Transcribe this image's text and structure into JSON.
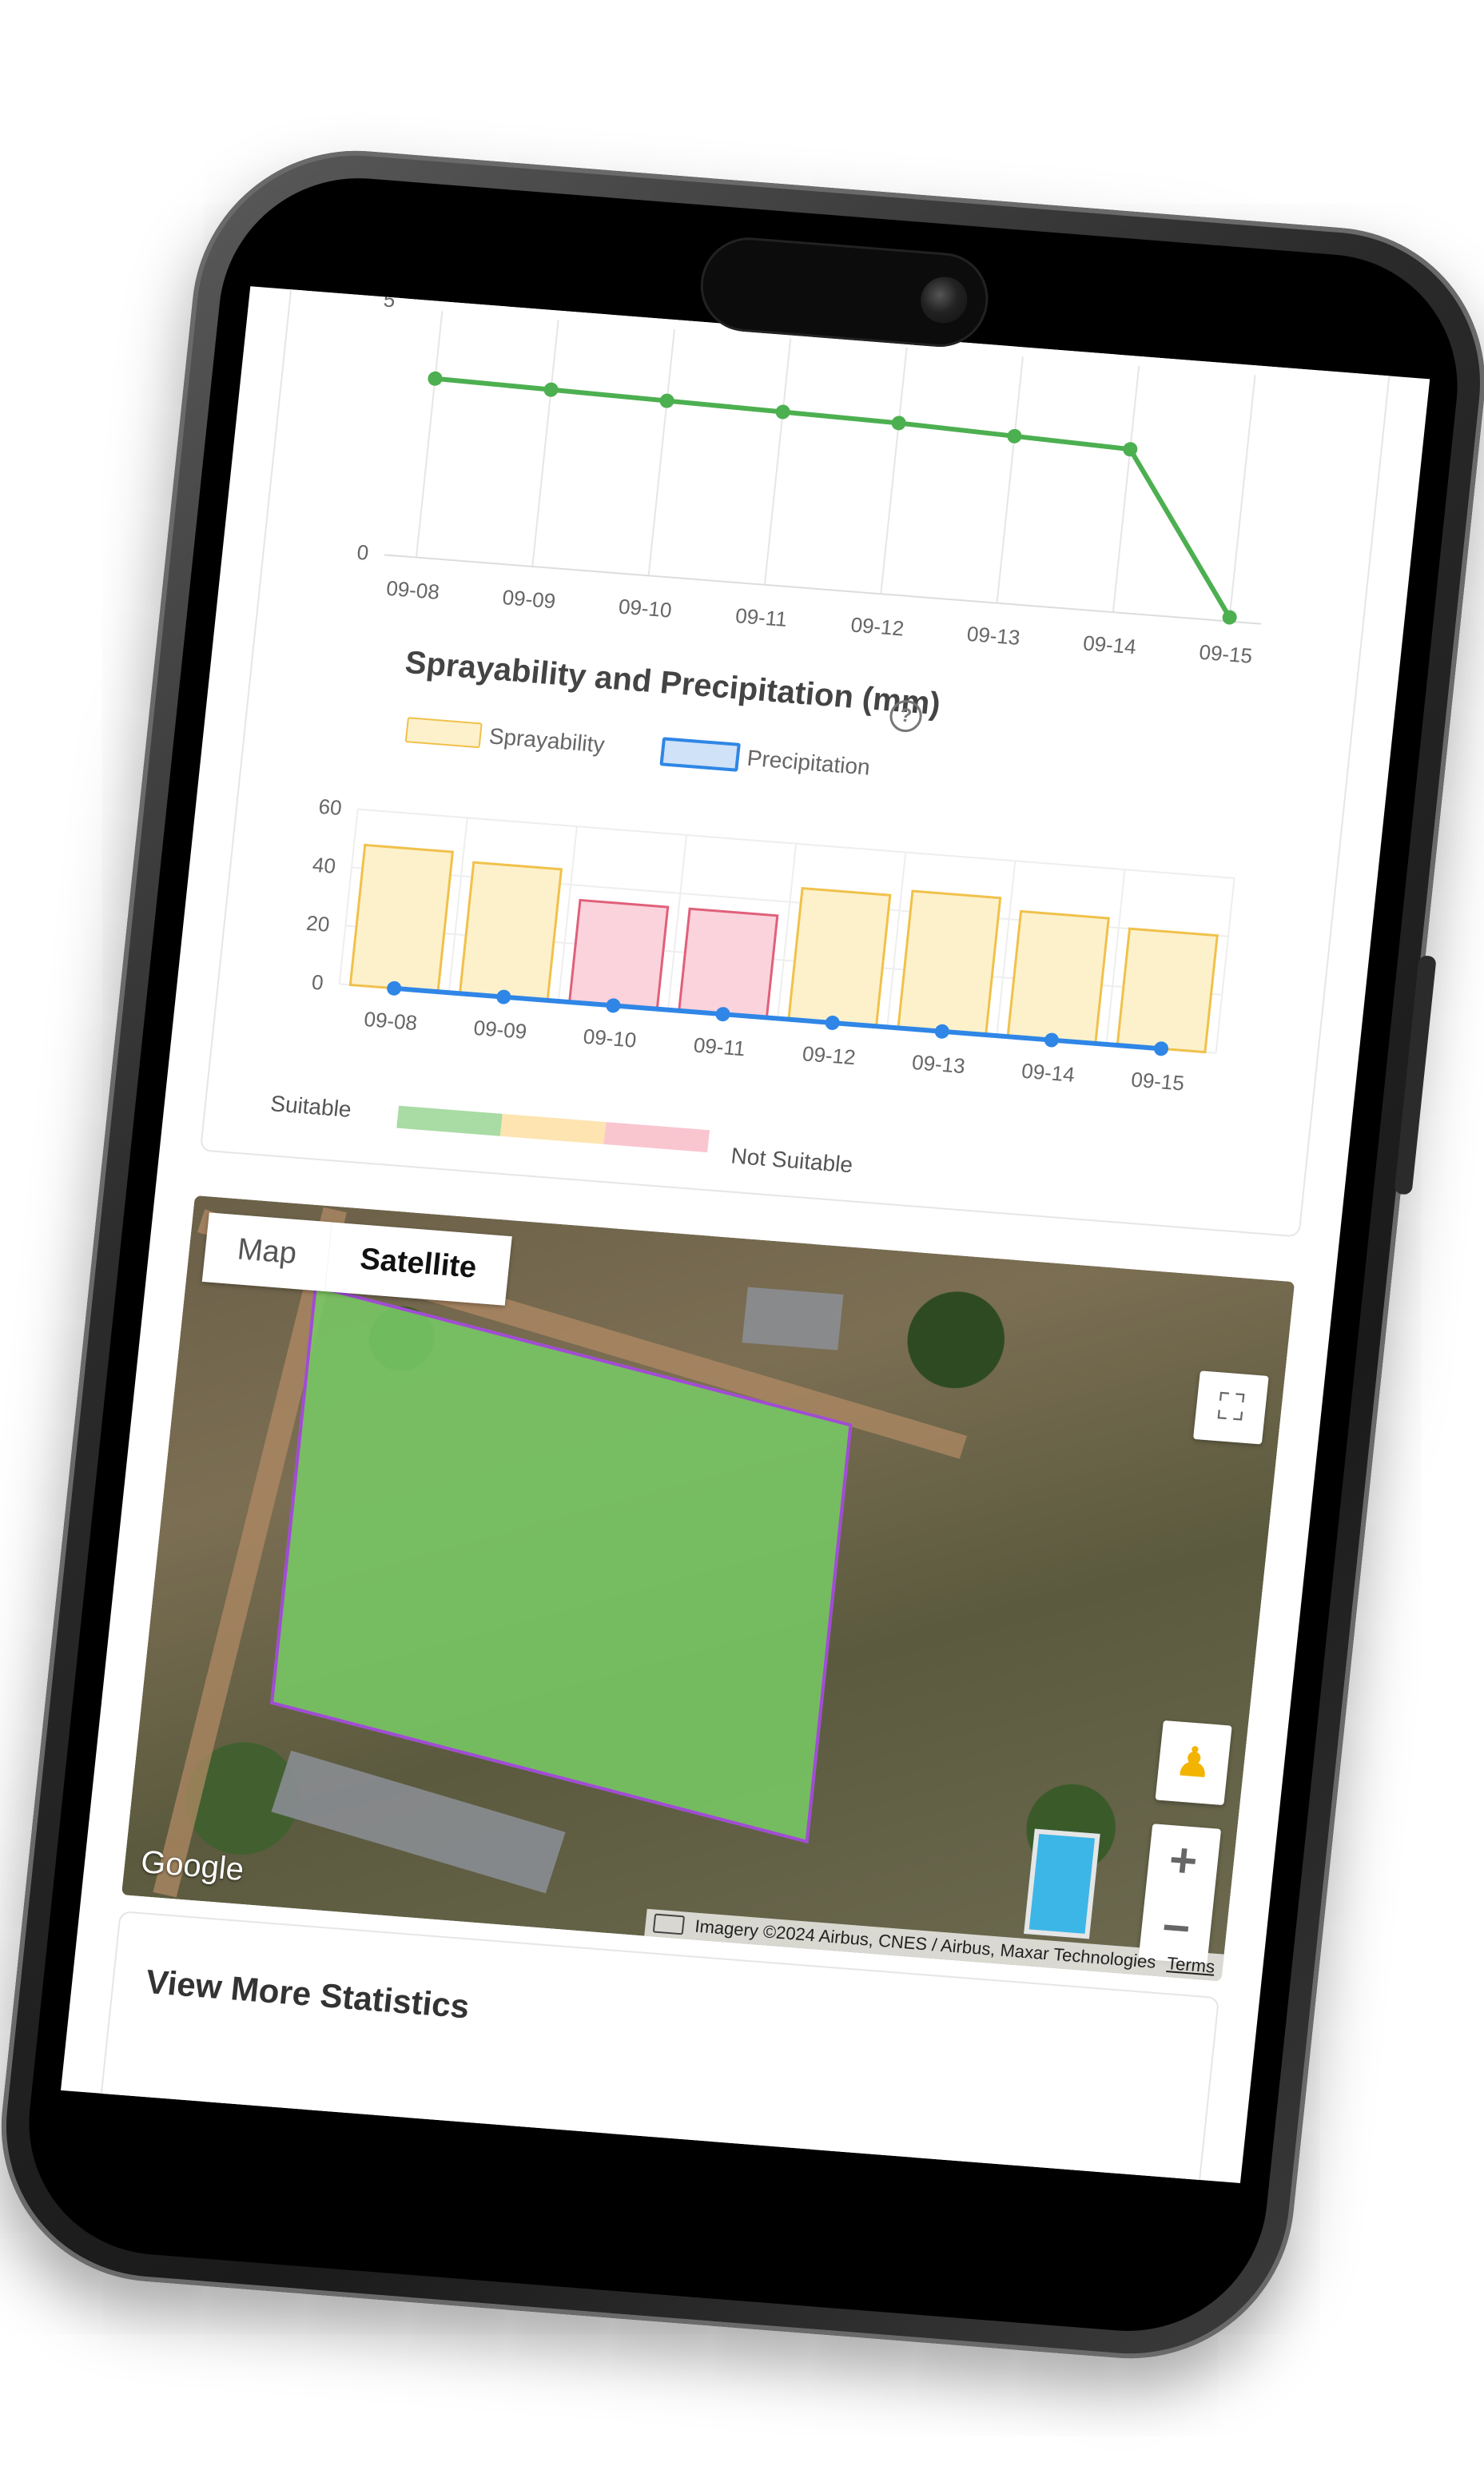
{
  "line_chart": {
    "y_ticks": [
      "5",
      "0"
    ],
    "x_labels": [
      "09-08",
      "09-09",
      "09-10",
      "09-11",
      "09-12",
      "09-13",
      "09-14",
      "09-15"
    ]
  },
  "spray_chart": {
    "title": "Sprayability and Precipitation (mm)",
    "help_icon": "?",
    "legend": {
      "sprayability": "Sprayability",
      "precipitation": "Precipitation"
    },
    "y_ticks": [
      "60",
      "40",
      "20",
      "0"
    ],
    "scale": {
      "suitable": "Suitable",
      "not_suitable": "Not Suitable"
    }
  },
  "map": {
    "tabs": [
      "Map",
      "Satellite"
    ],
    "active_tab": "Satellite",
    "google": "Google",
    "attribution": "Imagery ©2024 Airbus, CNES / Airbus, Maxar Technologies",
    "terms": "Terms",
    "zoom_in": "+",
    "zoom_out": "−"
  },
  "stats": {
    "title": "View More Statistics",
    "expand": "+"
  },
  "colors": {
    "line": "#4caf50",
    "spray_fill": "#fdf1cc",
    "spray_stroke": "#f0c14b",
    "spray_bad_fill": "#fbd3dc",
    "spray_bad_stroke": "#e0607a",
    "precip": "#2f86e6",
    "suit_good": "#a9dba5",
    "suit_mid": "#fde4b0",
    "suit_bad": "#f9c6d0",
    "field": "#78c864",
    "field_border": "#a24bd6"
  },
  "chart_data": [
    {
      "type": "line",
      "x": [
        "09-08",
        "09-09",
        "09-10",
        "09-11",
        "09-12",
        "09-13",
        "09-14",
        "09-15"
      ],
      "series": [
        {
          "values": [
            4.5,
            4.45,
            4.4,
            4.35,
            4.3,
            4.2,
            4.1,
            0.1
          ]
        }
      ],
      "ylim": [
        0,
        5
      ]
    },
    {
      "type": "bar",
      "title": "Sprayability and Precipitation (mm)",
      "categories": [
        "09-08",
        "09-09",
        "09-10",
        "09-11",
        "09-12",
        "09-13",
        "09-14",
        "09-15"
      ],
      "series": [
        {
          "name": "Sprayability",
          "values": [
            48,
            45,
            35,
            35,
            45,
            47,
            43,
            40
          ]
        },
        {
          "name": "Precipitation",
          "values": [
            0,
            0,
            0,
            0,
            0,
            0,
            0,
            0
          ]
        }
      ],
      "ylim": [
        0,
        60
      ],
      "legend": "top-center"
    }
  ]
}
